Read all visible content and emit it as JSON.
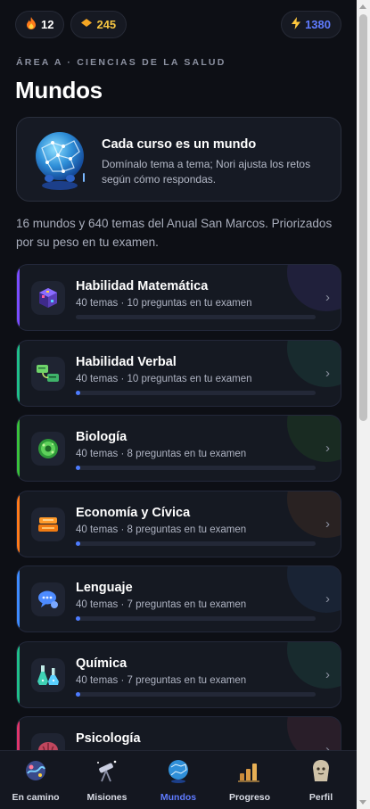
{
  "topbar": {
    "streak": {
      "icon": "fire-icon",
      "value": "12"
    },
    "gems": {
      "icon": "gem-icon",
      "value": "245"
    },
    "energy": {
      "icon": "bolt-icon",
      "value": "1380"
    }
  },
  "header": {
    "eyebrow": "ÁREA A · CIENCIAS DE LA SALUD",
    "title": "Mundos"
  },
  "intro": {
    "icon": "globe-icon",
    "title": "Cada curso es un mundo",
    "text": "Domínalo tema a tema; Nori ajusta los retos según cómo respondas."
  },
  "summary": "16 mundos y 640 temas del Anual San Marcos. Priorizados por su peso en tu examen.",
  "worlds": [
    {
      "name": "Habilidad Matemática",
      "meta": "40 temas · 10 preguntas en tu examen",
      "icon": "cube-icon",
      "accent": "#7a4cff",
      "progress": 0
    },
    {
      "name": "Habilidad Verbal",
      "meta": "40 temas · 10 preguntas en tu examen",
      "icon": "chat-bubbles-icon",
      "accent": "#1fbf8a",
      "progress": 0.02
    },
    {
      "name": "Biología",
      "meta": "40 temas · 8 preguntas en tu examen",
      "icon": "cell-icon",
      "accent": "#39c23b",
      "progress": 0.02
    },
    {
      "name": "Economía y Cívica",
      "meta": "40 temas · 8 preguntas en tu examen",
      "icon": "coins-icon",
      "accent": "#ff7a1a",
      "progress": 0.02
    },
    {
      "name": "Lenguaje",
      "meta": "40 temas · 7 preguntas en tu examen",
      "icon": "speech-bubble-icon",
      "accent": "#3d8bff",
      "progress": 0.02
    },
    {
      "name": "Química",
      "meta": "40 temas · 7 preguntas en tu examen",
      "icon": "flask-icon",
      "accent": "#1fbf8a",
      "progress": 0.02
    },
    {
      "name": "Psicología",
      "meta": "",
      "icon": "brain-icon",
      "accent": "#e0356b",
      "progress": 0
    }
  ],
  "nav": [
    {
      "label": "En camino",
      "icon": "path-planet-icon",
      "active": false
    },
    {
      "label": "Misiones",
      "icon": "telescope-icon",
      "active": false
    },
    {
      "label": "Mundos",
      "icon": "globe-icon",
      "active": true
    },
    {
      "label": "Progreso",
      "icon": "bar-chart-icon",
      "active": false
    },
    {
      "label": "Perfil",
      "icon": "profile-icon",
      "active": false
    }
  ],
  "colors": {
    "accent": "#5f7bff",
    "background": "#0d0f15",
    "card": "#151922"
  }
}
